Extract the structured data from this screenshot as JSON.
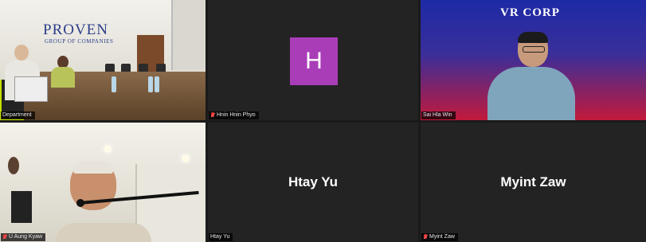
{
  "meeting": {
    "participants": [
      {
        "id": "department",
        "label": "Department",
        "muted": false,
        "active": true
      },
      {
        "id": "hnin-hnin-phyo",
        "label": "Hnin Hnin Phyo",
        "muted": true,
        "avatar_initial": "H",
        "avatar_color": "#a93db8"
      },
      {
        "id": "sai-hla-win",
        "label": "Sai Hla Win",
        "muted": false
      },
      {
        "id": "u-aung-kyaw",
        "label": "U Aung Kyaw",
        "muted": true
      },
      {
        "id": "htay-yu",
        "label": "Htay Yu",
        "display_name": "Htay Yu",
        "muted": false
      },
      {
        "id": "myint-zaw",
        "label": "Myint Zaw",
        "display_name": "Myint Zaw",
        "muted": true
      }
    ]
  },
  "scene_text": {
    "department_logo": "PROVEN",
    "department_logo_sub": "GROUP OF COMPANIES",
    "sai_logo": "VR CORP"
  },
  "colors": {
    "active_speaker_outline": "#c6e000",
    "tile_background": "#232323"
  }
}
